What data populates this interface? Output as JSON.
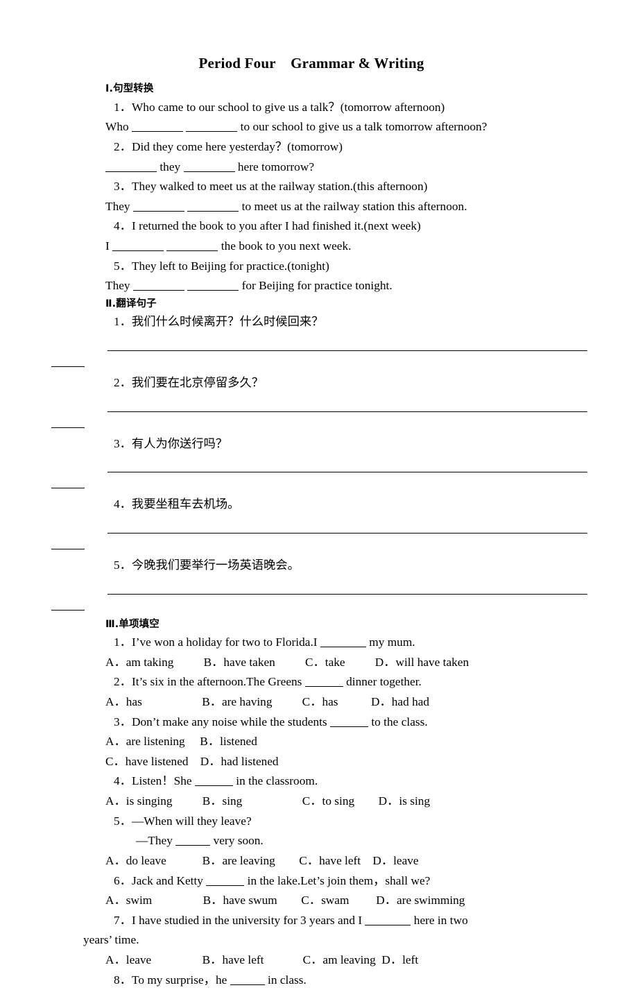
{
  "document": {
    "title": "Period Four    Grammar & Writing"
  },
  "section1": {
    "heading": "Ⅰ.句型转换",
    "items": [
      {
        "prompt": "1．Who came to our school to give us a talk？(tomorrow afternoon)",
        "answer_pre": "Who ",
        "answer_mid": " ",
        "answer_post": " to our school to give us a talk tomorrow afternoon?"
      },
      {
        "prompt": "2．Did they come here yesterday？(tomorrow)",
        "answer_pre": "",
        "answer_mid": " they ",
        "answer_post": " here tomorrow?"
      },
      {
        "prompt": "3．They walked to meet us at the railway station.(this afternoon)",
        "answer_pre": "They ",
        "answer_mid": " ",
        "answer_post": " to meet us at the railway station this afternoon."
      },
      {
        "prompt": "4．I returned the book to you after I had finished it.(next week)",
        "answer_pre": "I ",
        "answer_mid": " ",
        "answer_post": " the book to you next week."
      },
      {
        "prompt": "5．They left to Beijing for practice.(tonight)",
        "answer_pre": "They ",
        "answer_mid": " ",
        "answer_post": " for Beijing for practice tonight."
      }
    ]
  },
  "section2": {
    "heading": "Ⅱ.翻译句子",
    "items": [
      {
        "prompt": "1．我们什么时候离开？什么时候回来？"
      },
      {
        "prompt": "2．我们要在北京停留多久？"
      },
      {
        "prompt": "3．有人为你送行吗？"
      },
      {
        "prompt": "4．我要坐租车去机场。"
      },
      {
        "prompt": "5．今晚我们要举行一场英语晚会。"
      }
    ]
  },
  "section3": {
    "heading": "Ⅲ.单项填空",
    "items": [
      {
        "q_pre": "1．I’ve won a holiday for two to Florida.I ",
        "q_post": " my mum.",
        "options_line1": "A．am taking          B．have taken          C．take          D．will have taken"
      },
      {
        "q_pre": "2．It’s six in the afternoon.The Greens ",
        "q_post": " dinner together.",
        "options_line1": "A．has                    B．are having          C．has           D．had had"
      },
      {
        "q_pre": "3．Don’t make any noise while the students ",
        "q_post": " to the class.",
        "options_line1": "A．are listening     B．listened",
        "options_line2": "C．have listened    D．had listened"
      },
      {
        "q_pre": "4．Listen！She ",
        "q_post": " in the classroom.",
        "options_line1": "A．is singing          B．sing                    C．to sing        D．is sing"
      },
      {
        "q_line1": "5．—When will they leave?",
        "q_pre": "—They ",
        "q_post": " very soon.",
        "options_line1": "A．do leave            B．are leaving        C．have left    D．leave"
      },
      {
        "q_pre": "6．Jack and Ketty ",
        "q_post": " in the lake.Let’s join them，shall we?",
        "options_line1": "A．swim                 B．have swum        C．swam         D．are swimming"
      },
      {
        "q_pre": "7．I have studied in the university for 3 years and I ",
        "q_post": " here in two",
        "q_wrap": "years’ time.",
        "options_line1": "A．leave                 B．have left             C．am leaving  D．left"
      },
      {
        "q_pre": "8．To my surprise，he ",
        "q_post": " in class."
      }
    ]
  }
}
